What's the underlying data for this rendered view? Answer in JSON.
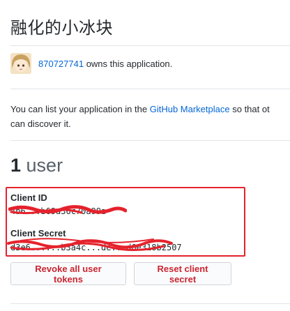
{
  "app": {
    "name": "融化的小冰块"
  },
  "owner": {
    "username": "870727741",
    "suffix_text": " owns this application."
  },
  "marketplace": {
    "text_before": "You can list your application in the ",
    "link_text": "GitHub Marketplace",
    "text_after": " so that ot",
    "line2": "can discover it."
  },
  "users": {
    "count": "1",
    "label": " user"
  },
  "credentials": {
    "client_id_label": "Client ID",
    "client_id_value": "4b6...b69a36c70a99a",
    "client_secret_label": "Client Secret",
    "client_secret_value": "d3e6......b3a4c...de...d6e318b2507",
    "highlight_color": "#e5222c",
    "redaction_color": "#e5222c"
  },
  "actions": {
    "revoke_label": "Revoke all user tokens",
    "reset_label": "Reset client secret"
  },
  "colors": {
    "link": "#0366d6",
    "danger": "#cb2431"
  }
}
